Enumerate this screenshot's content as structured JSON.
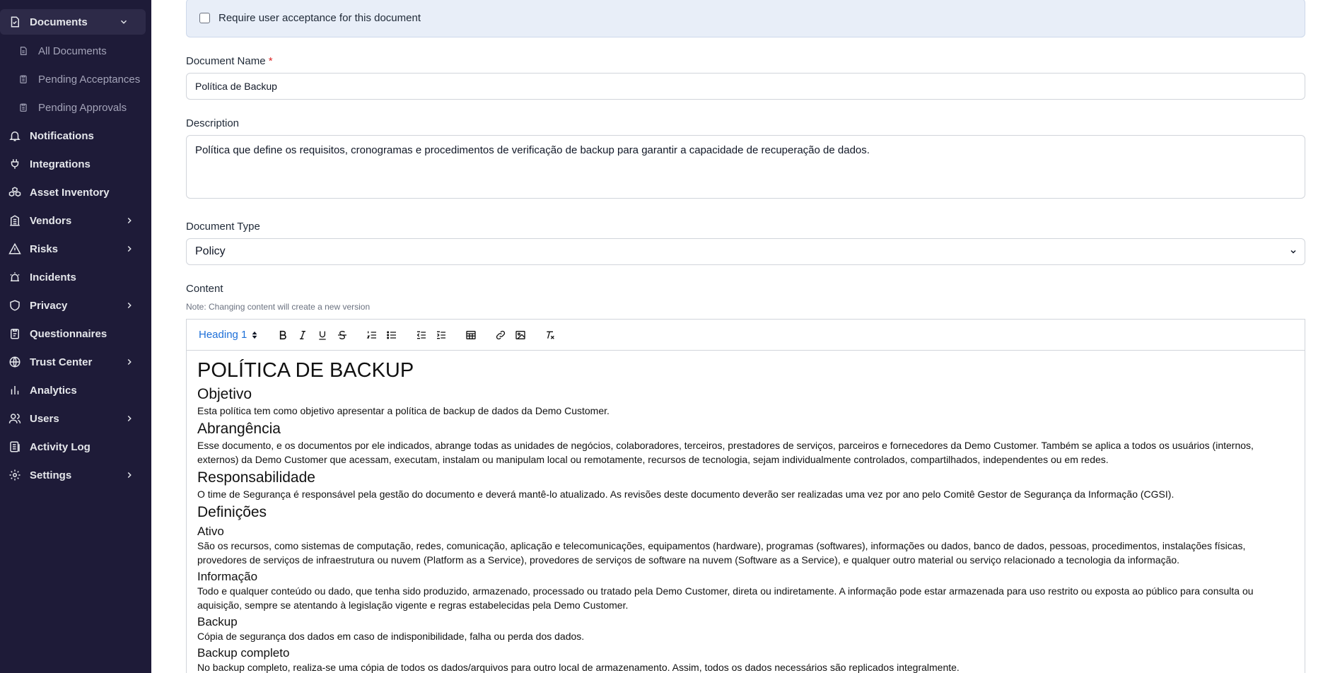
{
  "sidebar": {
    "documents": {
      "label": "Documents",
      "icon": "document-icon"
    },
    "sub_items": [
      {
        "label": "All Documents",
        "icon": "file-icon"
      },
      {
        "label": "Pending Acceptances",
        "icon": "clipboard-icon"
      },
      {
        "label": "Pending Approvals",
        "icon": "clipboard-icon"
      }
    ],
    "items": [
      {
        "label": "Notifications",
        "icon": "bell-icon"
      },
      {
        "label": "Integrations",
        "icon": "plug-icon"
      },
      {
        "label": "Asset Inventory",
        "icon": "cubes-icon"
      },
      {
        "label": "Vendors",
        "icon": "building-icon"
      },
      {
        "label": "Risks",
        "icon": "warning-icon"
      },
      {
        "label": "Incidents",
        "icon": "alarm-icon"
      },
      {
        "label": "Privacy",
        "icon": "shield-icon"
      },
      {
        "label": "Questionnaires",
        "icon": "clipboard-list-icon"
      },
      {
        "label": "Trust Center",
        "icon": "globe-icon"
      },
      {
        "label": "Analytics",
        "icon": "chart-icon"
      },
      {
        "label": "Users",
        "icon": "users-icon"
      },
      {
        "label": "Activity Log",
        "icon": "log-icon"
      },
      {
        "label": "Settings",
        "icon": "gear-icon"
      }
    ]
  },
  "form": {
    "require_acceptance_label": "Require user acceptance for this document",
    "name_label": "Document Name",
    "required_mark": "*",
    "name_value": "Política de Backup",
    "description_label": "Description",
    "description_value": "Política que define os requisitos, cronogramas e procedimentos de verificação de backup para garantir a capacidade de recuperação de dados.",
    "type_label": "Document Type",
    "type_value": "Policy",
    "content_label": "Content",
    "content_note": "Note: Changing content will create a new version"
  },
  "editor": {
    "heading_select": "Heading 1",
    "content": {
      "title": "POLÍTICA DE BACKUP",
      "objetivo_h": "Objetivo",
      "objetivo_p": "Esta política tem como objetivo apresentar a política de backup de dados da Demo Customer.",
      "abrangencia_h": "Abrangência",
      "abrangencia_p": "Esse documento, e os documentos por ele indicados, abrange todas as unidades de negócios, colaboradores, terceiros, prestadores de serviços, parceiros e fornecedores da Demo Customer. Também se aplica a todos os usuários (internos, externos) da Demo Customer que acessam, executam, instalam ou manipulam local ou remotamente, recursos de tecnologia, sejam individualmente controlados, compartilhados, independentes ou em redes.",
      "responsabilidade_h": "Responsabilidade",
      "responsabilidade_p": "O time de Segurança é responsável pela gestão do documento e deverá mantê-lo atualizado. As revisões deste documento deverão ser realizadas uma vez por ano pelo Comitê Gestor de Segurança da Informação (CGSI).",
      "definicoes_h": "Definições",
      "ativo_h": "Ativo",
      "ativo_p": "São os recursos, como sistemas de computação, redes, comunicação, aplicação e telecomunicações, equipamentos (hardware), programas (softwares), informações ou dados, banco de dados, pessoas, procedimentos, instalações físicas, provedores de serviços de infraestrutura ou nuvem (Platform as a Service), provedores de serviços de software na nuvem (Software as a Service), e qualquer outro material ou serviço relacionado a tecnologia da informação.",
      "informacao_h": "Informação",
      "informacao_p": "Todo e qualquer conteúdo ou dado, que tenha sido produzido, armazenado, processado ou tratado pela Demo Customer, direta ou indiretamente. A informação pode estar armazenada para uso restrito ou exposta ao público para consulta ou aquisição, sempre se atentando à legislação vigente e regras estabelecidas pela Demo Customer.",
      "backup_h": "Backup",
      "backup_p": "Cópia de segurança dos dados em caso de indisponibilidade, falha ou perda dos dados.",
      "backup_completo_h": "Backup completo",
      "backup_completo_p": "No backup completo, realiza-se uma cópia de todos os dados/arquivos para outro local de armazenamento. Assim, todos os dados necessários são replicados integralmente."
    }
  }
}
